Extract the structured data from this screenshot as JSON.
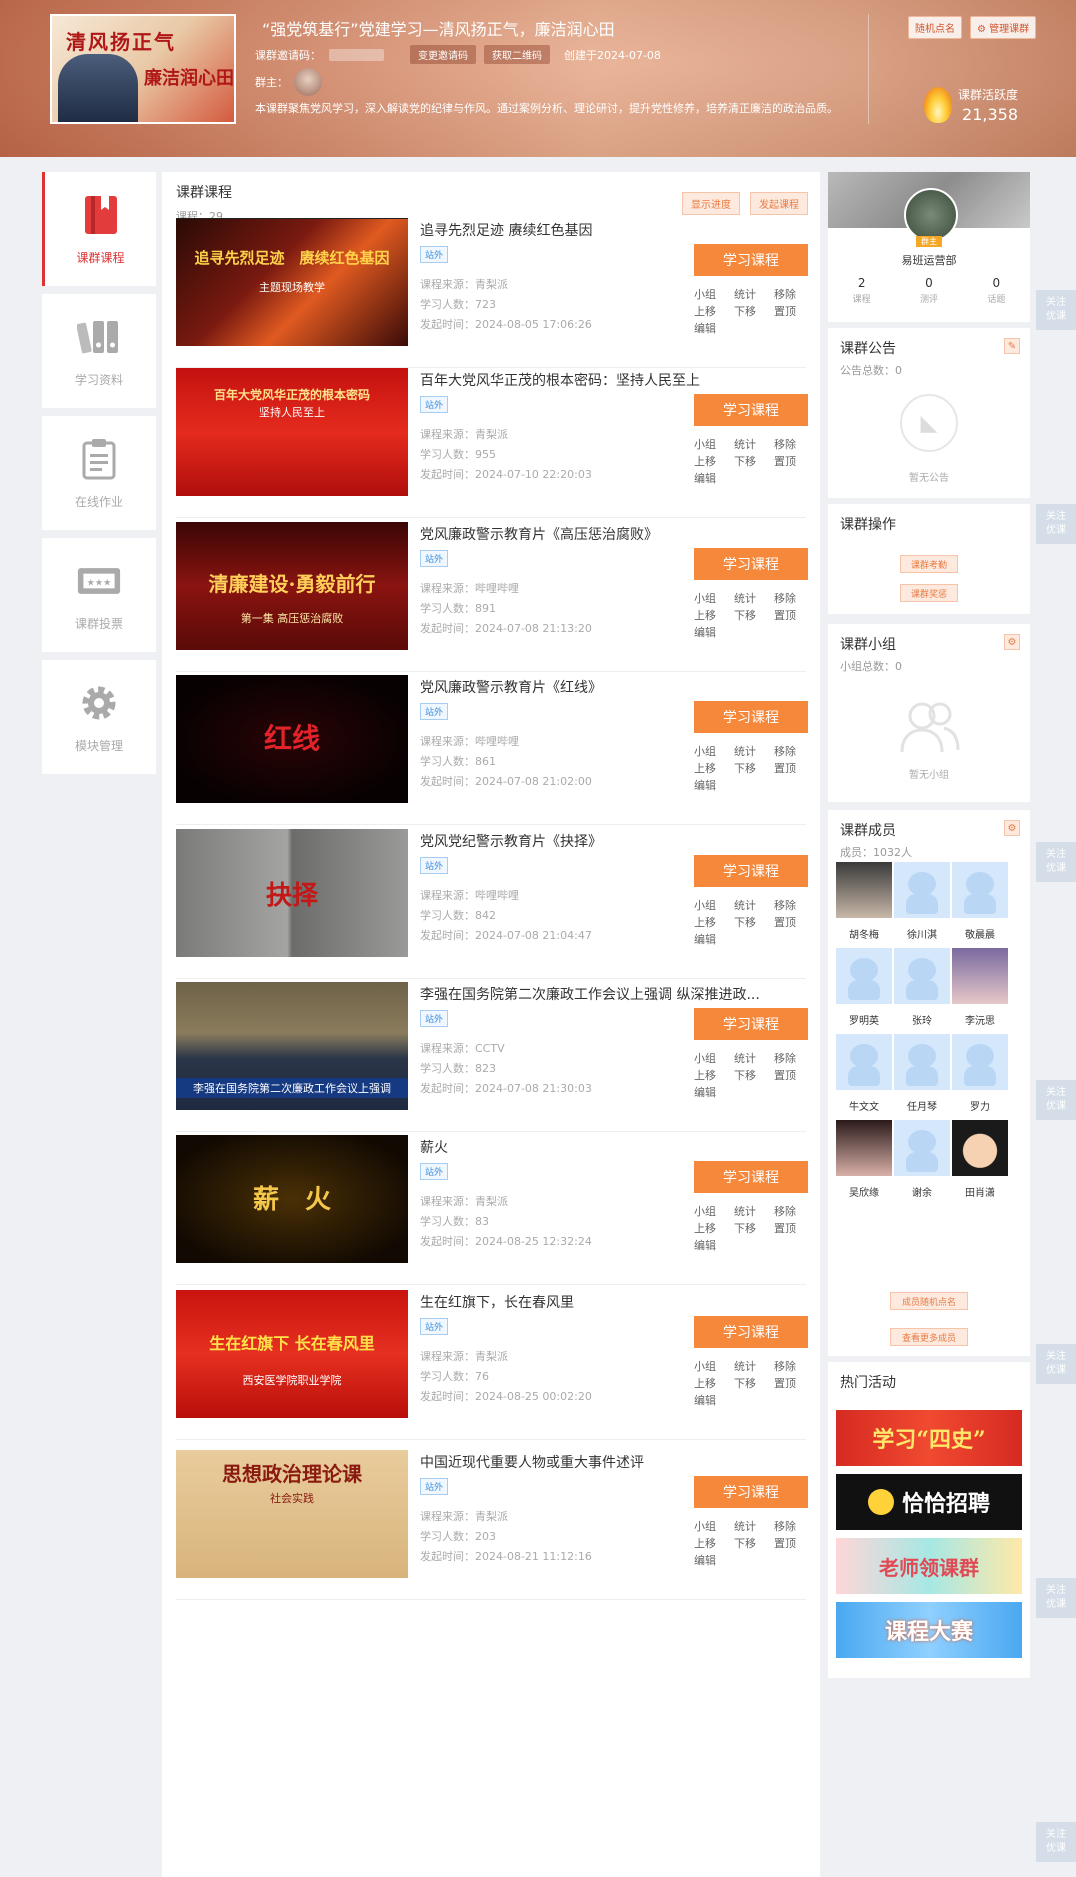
{
  "header": {
    "title": "“强党筑基行”党建学习—清风扬正气，廉洁润心田",
    "cover_line1": "清风扬正气",
    "cover_line2": "廉洁润心田",
    "invite_label": "课群邀请码：",
    "change_invite": "变更邀请码",
    "get_qrcode": "获取二维码",
    "created": "创建于2024-07-08",
    "owner_label": "群主：",
    "description": "本课群聚焦党风学习，深入解读党的纪律与作风。通过案例分析、理论研讨，提升党性修养，培养清正廉洁的政治品质。",
    "random_call": "随机点名",
    "manage": "管理课群",
    "activity_label": "课群活跃度",
    "activity_value": "21,358"
  },
  "nav": [
    {
      "label": "课群课程",
      "icon": "book-icon"
    },
    {
      "label": "学习资料",
      "icon": "binders-icon"
    },
    {
      "label": "在线作业",
      "icon": "clipboard-icon"
    },
    {
      "label": "课群投票",
      "icon": "ticket-icon"
    },
    {
      "label": "模块管理",
      "icon": "gear-icon"
    }
  ],
  "main": {
    "title": "课群课程",
    "count": "课程：29",
    "show_progress": "显示进度",
    "start_course": "发起课程",
    "study_label": "学习课程",
    "tag": "站外",
    "ops": {
      "group": "小组",
      "stats": "统计",
      "remove": "移除",
      "up": "上移",
      "down": "下移",
      "top": "置顶",
      "edit": "编辑"
    },
    "courses": [
      {
        "title": "追寻先烈足迹 赓续红色基因",
        "source": "课程来源：青梨派",
        "learners": "学习人数：723",
        "time": "发起时间：2024-08-05 17:06:26",
        "thumb_text": "追寻先烈足迹　赓续红色基因",
        "thumb_sub": "主题现场教学"
      },
      {
        "title": "百年大党风华正茂的根本密码：坚持人民至上",
        "source": "课程来源：青梨派",
        "learners": "学习人数：955",
        "time": "发起时间：2024-07-10 22:20:03",
        "thumb_text": "百年大党风华正茂的根本密码",
        "thumb_sub": "坚持人民至上"
      },
      {
        "title": "党风廉政警示教育片《高压惩治腐败》",
        "source": "课程来源：哔哩哔哩",
        "learners": "学习人数：891",
        "time": "发起时间：2024-07-08 21:13:20",
        "thumb_text": "清廉建设·勇毅前行",
        "thumb_sub": "第一集 高压惩治腐败"
      },
      {
        "title": "党风廉政警示教育片《红线》",
        "source": "课程来源：哔哩哔哩",
        "learners": "学习人数：861",
        "time": "发起时间：2024-07-08 21:02:00",
        "thumb_text": "红线",
        "thumb_sub": ""
      },
      {
        "title": "党风党纪警示教育片《抉择》",
        "source": "课程来源：哔哩哔哩",
        "learners": "学习人数：842",
        "time": "发起时间：2024-07-08 21:04:47",
        "thumb_text": "抉择",
        "thumb_sub": ""
      },
      {
        "title": "李强在国务院第二次廉政工作会议上强调 纵深推进政...",
        "source": "课程来源：CCTV",
        "learners": "学习人数：823",
        "time": "发起时间：2024-07-08 21:30:03",
        "thumb_text": "",
        "thumb_sub": "李强在国务院第二次廉政工作会议上强调"
      },
      {
        "title": "薪火",
        "source": "课程来源：青梨派",
        "learners": "学习人数：83",
        "time": "发起时间：2024-08-25 12:32:24",
        "thumb_text": "薪　火",
        "thumb_sub": ""
      },
      {
        "title": "生在红旗下，长在春风里",
        "source": "课程来源：青梨派",
        "learners": "学习人数：76",
        "time": "发起时间：2024-08-25 00:02:20",
        "thumb_text": "生在红旗下 长在春风里",
        "thumb_sub": "西安医学院职业学院"
      },
      {
        "title": "中国近现代重要人物或重大事件述评",
        "source": "课程来源：青梨派",
        "learners": "学习人数：203",
        "time": "发起时间：2024-08-21 11:12:16",
        "thumb_text": "思想政治理论课",
        "thumb_sub": "社会实践"
      }
    ]
  },
  "profile": {
    "name": "易班运营部",
    "role": "群主",
    "stats": [
      {
        "value": "2",
        "label": "课程"
      },
      {
        "value": "0",
        "label": "测评"
      },
      {
        "value": "0",
        "label": "话题"
      }
    ]
  },
  "announce": {
    "title": "课群公告",
    "count": "公告总数：0",
    "empty": "暂无公告"
  },
  "operations": {
    "title": "课群操作",
    "attendance": "课群考勤",
    "reward": "课群奖惩"
  },
  "groups": {
    "title": "课群小组",
    "count": "小组总数：0",
    "empty": "暂无小组"
  },
  "members": {
    "title": "课群成员",
    "count": "成员：1032人",
    "list": [
      "胡冬梅",
      "徐川淇",
      "敬晨晨",
      "罗明英",
      "张玲",
      "李沅思",
      "牛文文",
      "任月琴",
      "罗力",
      "吴欣缘",
      "谢余",
      "田肖潇"
    ],
    "random_call": "成员随机点名",
    "view_more": "查看更多成员"
  },
  "hot": {
    "title": "热门活动",
    "banners": [
      "学习“四史”",
      "恰恰招聘",
      "老师领课群",
      "课程大赛"
    ]
  },
  "follow": {
    "line1": "关注",
    "line2": "优课"
  }
}
